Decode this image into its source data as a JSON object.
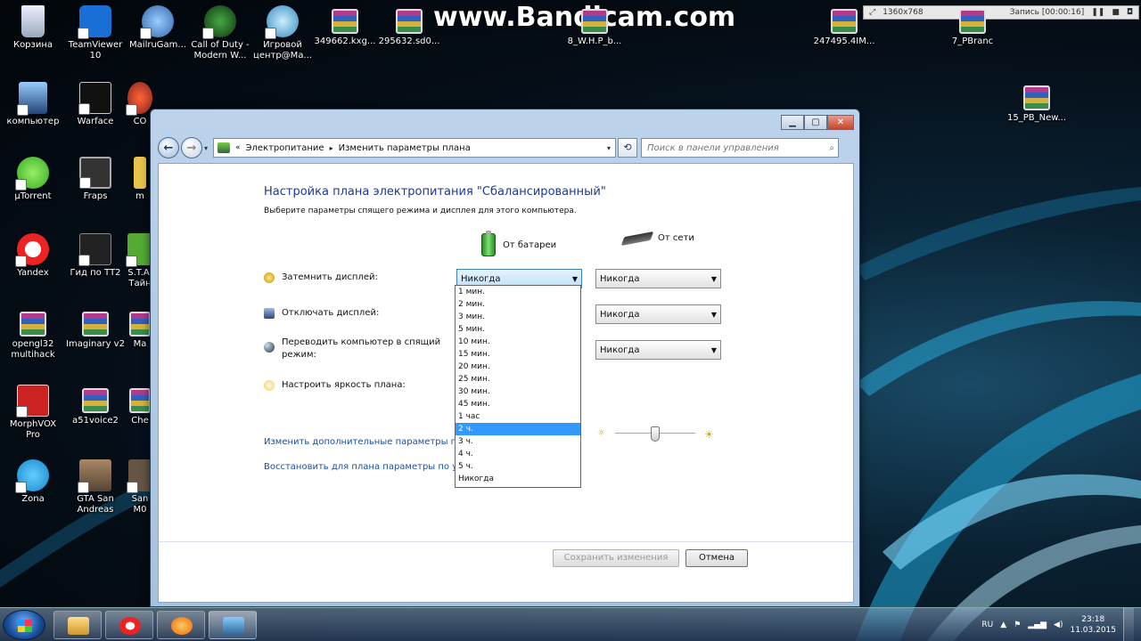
{
  "watermark": "www.Bandicam.com",
  "recorder": {
    "resolution": "1360x768",
    "status": "Запись [00:00:16]"
  },
  "desktop_icons": [
    {
      "label": "Корзина"
    },
    {
      "label": "TeamViewer 10"
    },
    {
      "label": "MailruGam..."
    },
    {
      "label": "Call of Duty - Modern W..."
    },
    {
      "label": "Игровой центр@Ма..."
    },
    {
      "label": "349662.kxg..."
    },
    {
      "label": "295632.sd0..."
    },
    {
      "label": "8_W.H.P_b..."
    },
    {
      "label": "247495.4IM..."
    },
    {
      "label": "7_PBranc"
    },
    {
      "label": "компьютер"
    },
    {
      "label": "Warface"
    },
    {
      "label": "CO"
    },
    {
      "label": "15_PB_New..."
    },
    {
      "label": "µTorrent"
    },
    {
      "label": "Fraps"
    },
    {
      "label": "m"
    },
    {
      "label": "Yandex"
    },
    {
      "label": "Гид по ТТ2"
    },
    {
      "label": "S.T.A. Тайн"
    },
    {
      "label": "opengl32 multihack"
    },
    {
      "label": "Imaginary v2"
    },
    {
      "label": "Ma"
    },
    {
      "label": "MorphVOX Pro"
    },
    {
      "label": "a51voice2"
    },
    {
      "label": "Che"
    },
    {
      "label": "Zona"
    },
    {
      "label": "GTA San Andreas"
    },
    {
      "label": "San M0"
    }
  ],
  "window": {
    "breadcrumb": [
      "Электропитание",
      "Изменить параметры плана"
    ],
    "search_placeholder": "Поиск в панели управления",
    "heading": "Настройка плана электропитания \"Сбалансированный\"",
    "subheading": "Выберите параметры спящего режима и дисплея для этого компьютера.",
    "col_battery": "От батареи",
    "col_ac": "От сети",
    "settings": [
      {
        "label": "Затемнить дисплей:",
        "battery": "Никогда",
        "ac": "Никогда"
      },
      {
        "label": "Отключать дисплей:",
        "battery": "",
        "ac": "Никогда"
      },
      {
        "label": "Переводить компьютер в спящий режим:",
        "battery": "",
        "ac": "Никогда"
      },
      {
        "label": "Настроить яркость плана:"
      }
    ],
    "link_advanced": "Изменить дополнительные параметры п",
    "link_restore": "Восстановить для плана параметры по ум",
    "save_button": "Сохранить изменения",
    "cancel_button": "Отмена",
    "dropdown_options": [
      "1 мин.",
      "2 мин.",
      "3 мин.",
      "5 мин.",
      "10 мин.",
      "15 мин.",
      "20 мин.",
      "25 мин.",
      "30 мин.",
      "45 мин.",
      "1 час",
      "2 ч.",
      "3 ч.",
      "4 ч.",
      "5 ч.",
      "Никогда"
    ],
    "dropdown_highlighted": "2 ч.",
    "brightness_percent": 50
  },
  "taskbar": {
    "lang": "RU",
    "time": "23:18",
    "date": "11.03.2015"
  }
}
